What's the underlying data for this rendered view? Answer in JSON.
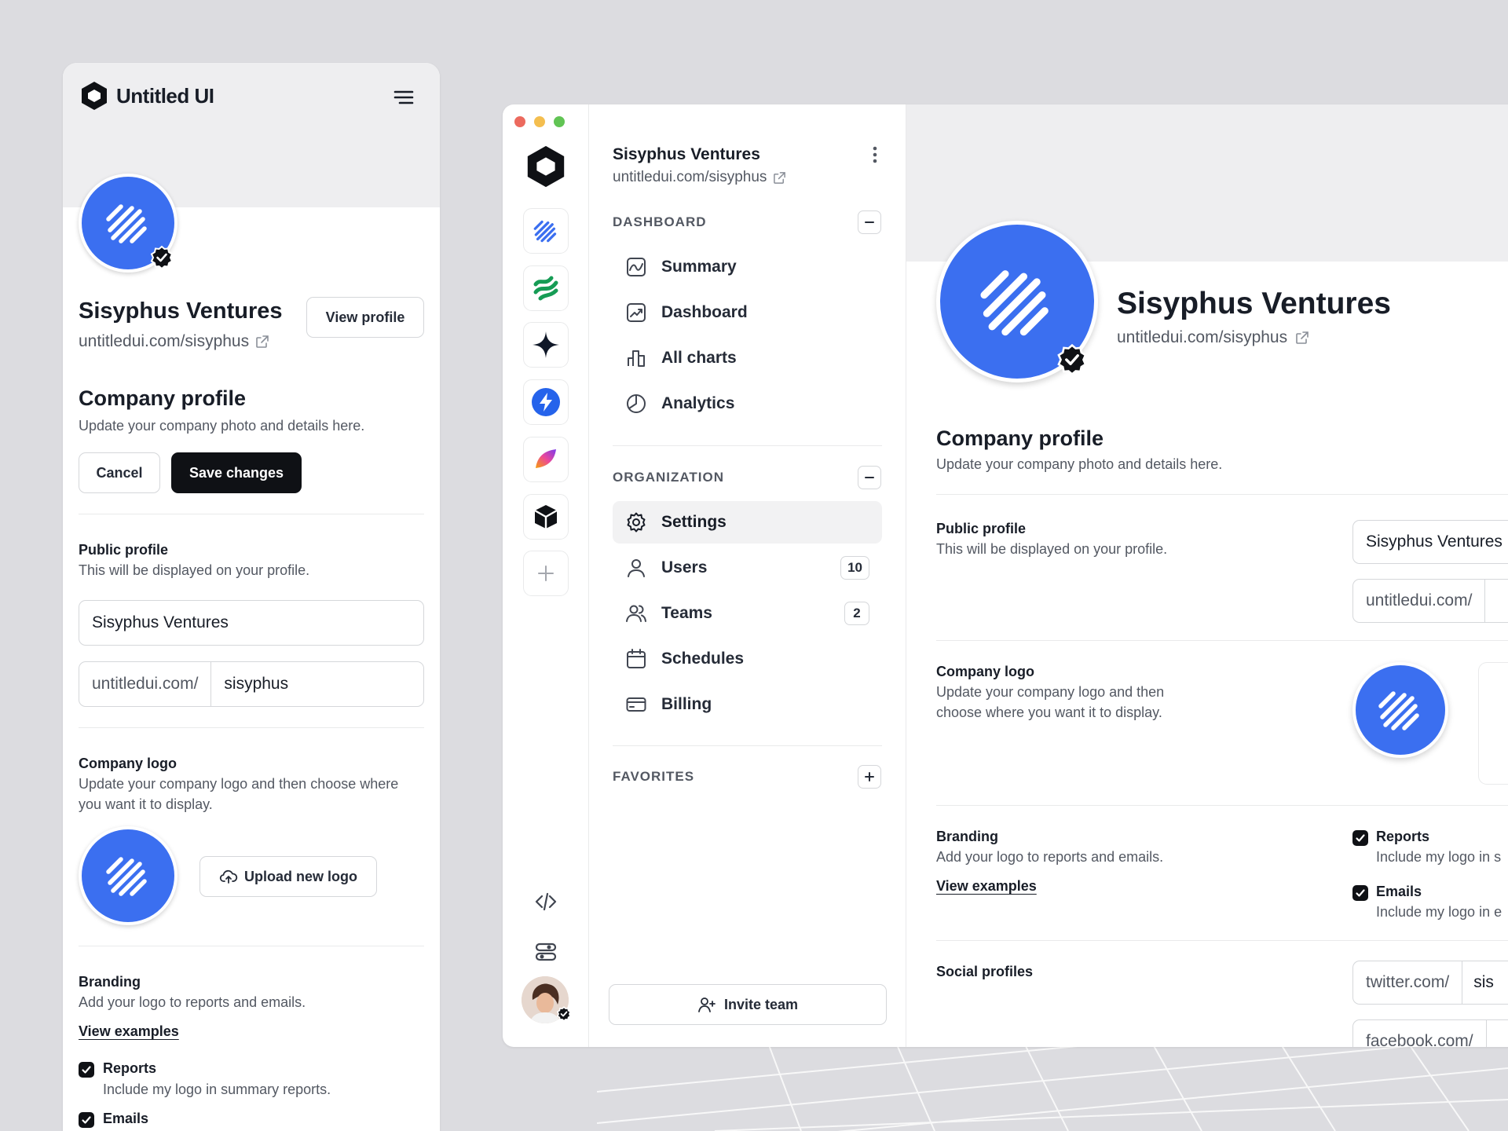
{
  "brand": {
    "name": "Untitled UI"
  },
  "company": {
    "name": "Sisyphus Ventures",
    "url": "untitledui.com/sisyphus"
  },
  "mobile": {
    "view_profile": "View profile",
    "section_title": "Company profile",
    "section_sub": "Update your company photo and details here.",
    "cancel": "Cancel",
    "save": "Save changes",
    "public_profile_label": "Public profile",
    "public_profile_sub": "This will be displayed on your profile.",
    "name_value": "Sisyphus Ventures",
    "url_prefix": "untitledui.com/",
    "url_value": "sisyphus",
    "logo_label": "Company logo",
    "logo_sub": "Update your company logo and then choose where you want it to display.",
    "upload": "Upload new logo",
    "branding_label": "Branding",
    "branding_sub": "Add your logo to reports and emails.",
    "view_examples": "View examples",
    "reports_label": "Reports",
    "reports_sub": "Include my logo in summary reports.",
    "emails_label": "Emails"
  },
  "nav": {
    "dashboard_heading": "DASHBOARD",
    "dashboard_items": [
      {
        "label": "Summary",
        "icon": "summary-icon"
      },
      {
        "label": "Dashboard",
        "icon": "dashboard-icon"
      },
      {
        "label": "All charts",
        "icon": "bar-chart-icon"
      },
      {
        "label": "Analytics",
        "icon": "pie-chart-icon"
      }
    ],
    "org_heading": "ORGANIZATION",
    "org_items": [
      {
        "label": "Settings",
        "icon": "gear-icon",
        "active": true
      },
      {
        "label": "Users",
        "icon": "user-icon",
        "badge": "10"
      },
      {
        "label": "Teams",
        "icon": "users-icon",
        "badge": "2"
      },
      {
        "label": "Schedules",
        "icon": "calendar-icon"
      },
      {
        "label": "Billing",
        "icon": "credit-card-icon"
      }
    ],
    "favorites_heading": "FAVORITES",
    "invite": "Invite team"
  },
  "desktop": {
    "section_title": "Company profile",
    "section_sub": "Update your company photo and details here.",
    "public_profile_label": "Public profile",
    "public_profile_sub": "This will be displayed on your profile.",
    "name_value": "Sisyphus Ventures",
    "url_prefix": "untitledui.com/",
    "logo_label": "Company logo",
    "logo_sub_1": "Update your company logo and then",
    "logo_sub_2": "choose where you want it to display.",
    "branding_label": "Branding",
    "branding_sub": "Add your logo to reports and emails.",
    "view_examples": "View examples",
    "reports_label": "Reports",
    "reports_sub": "Include my logo in s",
    "emails_label": "Emails",
    "emails_sub": "Include my logo in e",
    "social_label": "Social profiles",
    "twitter_prefix": "twitter.com/",
    "twitter_value": "sis",
    "facebook_prefix": "facebook.com/"
  },
  "colors": {
    "accent": "#3B6FF0",
    "dark": "#0F1115",
    "background": "#DCDCE0"
  }
}
